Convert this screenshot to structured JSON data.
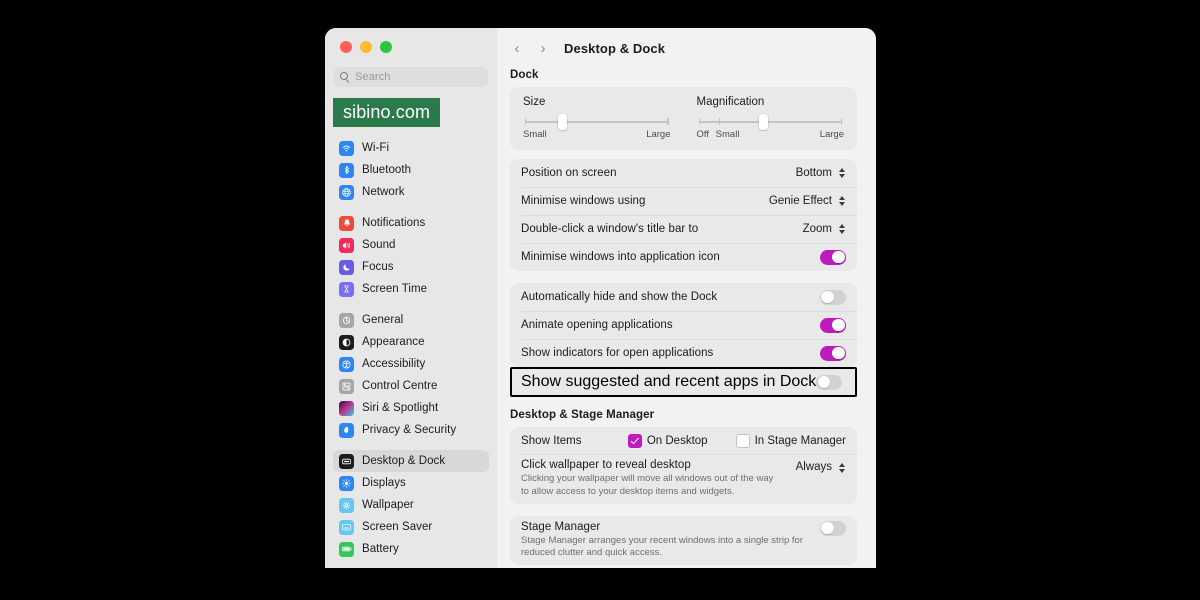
{
  "window": {
    "traffic_lights": [
      "close",
      "minimise",
      "zoom"
    ],
    "search": {
      "placeholder": "Search",
      "icon": "search-icon"
    },
    "badge": {
      "text": "sibino.com",
      "color": "#2b7a4b"
    }
  },
  "sidebar": {
    "groups": [
      {
        "items": [
          {
            "label": "Wi-Fi",
            "icon": "wifi-icon",
            "color": "#2e86f5",
            "selected": false
          },
          {
            "label": "Bluetooth",
            "icon": "bluetooth-icon",
            "color": "#2e86f5",
            "selected": false
          },
          {
            "label": "Network",
            "icon": "globe-icon",
            "color": "#2e86f5",
            "selected": false
          }
        ]
      },
      {
        "items": [
          {
            "label": "Notifications",
            "icon": "bell-icon",
            "color": "#ee4b3c",
            "selected": false
          },
          {
            "label": "Sound",
            "icon": "speaker-icon",
            "color": "#f2295b",
            "selected": false
          },
          {
            "label": "Focus",
            "icon": "moon-icon",
            "color": "#6b5ce7",
            "selected": false
          },
          {
            "label": "Screen Time",
            "icon": "hourglass-icon",
            "color": "#7b6ef0",
            "selected": false
          }
        ]
      },
      {
        "items": [
          {
            "label": "General",
            "icon": "gear-icon",
            "color": "#a5a5aa",
            "selected": false
          },
          {
            "label": "Appearance",
            "icon": "appearance-icon",
            "color": "#1c1c1e",
            "selected": false
          },
          {
            "label": "Accessibility",
            "icon": "accessibility-icon",
            "color": "#2e86f5",
            "selected": false
          },
          {
            "label": "Control Centre",
            "icon": "control-centre-icon",
            "color": "#a5a5aa",
            "selected": false
          },
          {
            "label": "Siri & Spotlight",
            "icon": "siri-icon",
            "color": "#7b3fe4",
            "selected": false
          },
          {
            "label": "Privacy & Security",
            "icon": "hand-icon",
            "color": "#2e86f5",
            "selected": false
          }
        ]
      },
      {
        "items": [
          {
            "label": "Desktop & Dock",
            "icon": "dock-icon",
            "color": "#1c1c1e",
            "selected": true
          },
          {
            "label": "Displays",
            "icon": "display-brightness-icon",
            "color": "#2e86f5",
            "selected": false
          },
          {
            "label": "Wallpaper",
            "icon": "wallpaper-icon",
            "color": "#63c6f5",
            "selected": false
          },
          {
            "label": "Screen Saver",
            "icon": "screen-saver-icon",
            "color": "#63c6f5",
            "selected": false
          },
          {
            "label": "Battery",
            "icon": "battery-icon",
            "color": "#34c759",
            "selected": false
          }
        ]
      }
    ]
  },
  "main": {
    "nav": {
      "back": "‹",
      "forward": "›"
    },
    "title": "Desktop & Dock",
    "dock_section": {
      "heading": "Dock",
      "sliders": [
        {
          "label": "Size",
          "min_label": "Small",
          "max_label": "Large",
          "value_pct": 26
        },
        {
          "label": "Magnification",
          "off_label": "Off",
          "min_label": "Small",
          "max_label": "Large",
          "value_pct": 45
        }
      ],
      "rows": [
        {
          "label": "Position on screen",
          "value": "Bottom",
          "control": "popup"
        },
        {
          "label": "Minimise windows using",
          "value": "Genie Effect",
          "control": "popup"
        },
        {
          "label": "Double-click a window's title bar to",
          "value": "Zoom",
          "control": "popup"
        },
        {
          "label": "Minimise windows into application icon",
          "control": "toggle",
          "on": true
        }
      ],
      "rows2": [
        {
          "label": "Automatically hide and show the Dock",
          "control": "toggle",
          "on": false
        },
        {
          "label": "Animate opening applications",
          "control": "toggle",
          "on": true
        },
        {
          "label": "Show indicators for open applications",
          "control": "toggle",
          "on": true
        }
      ],
      "highlighted_row": {
        "label": "Show suggested and recent apps in Dock",
        "control": "toggle",
        "on": false,
        "highlight_color": "#000000"
      }
    },
    "stage_section": {
      "heading": "Desktop & Stage Manager",
      "show_items": {
        "label": "Show Items",
        "checkboxes": [
          {
            "label": "On Desktop",
            "checked": true
          },
          {
            "label": "In Stage Manager",
            "checked": false
          }
        ]
      },
      "click_wallpaper": {
        "label": "Click wallpaper to reveal desktop",
        "value": "Always",
        "description": "Clicking your wallpaper will move all windows out of the way to allow access to your desktop items and widgets."
      },
      "stage_manager": {
        "label": "Stage Manager",
        "description": "Stage Manager arranges your recent windows into a single strip for reduced clutter and quick access.",
        "on": false
      }
    }
  },
  "colors": {
    "accent": "#bd1bbd",
    "selected_bg": "#d8d8da",
    "card_bg": "#e9e9ea"
  }
}
